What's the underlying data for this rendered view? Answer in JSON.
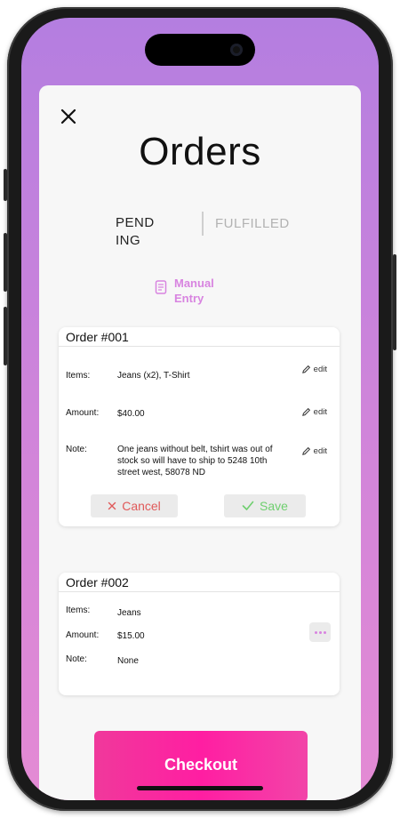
{
  "screen": {
    "title": "Orders"
  },
  "tabs": [
    {
      "label": "PEND ING",
      "active": true
    },
    {
      "label": "FULFILLED",
      "active": false
    }
  ],
  "manual_entry": {
    "label": "Manual Entry",
    "icon": "document-icon"
  },
  "orders": [
    {
      "title": "Order #001",
      "items_label": "Items:",
      "items": "Jeans (x2), T-Shirt",
      "amount_label": "Amount:",
      "amount": "$40.00",
      "note_label": "Note:",
      "note": "One jeans without belt, tshirt was out of stock so will have to ship to 5248 10th street west, 58078 ND",
      "edit_label": "edit",
      "cancel_label": "Cancel",
      "save_label": "Save"
    },
    {
      "title": "Order #002",
      "items_label": "Items:",
      "items": "Jeans",
      "amount_label": "Amount:",
      "amount": "$15.00",
      "note_label": "Note:",
      "note": "None"
    }
  ],
  "checkout": {
    "label": "Checkout"
  },
  "colors": {
    "accent_pink": "#ff1ea2",
    "manual_entry": "#d884e0",
    "cancel": "#e05a5a",
    "save": "#6fcf6f",
    "background_gradient_top": "#b47ee0",
    "background_gradient_bottom": "#e48ad4"
  }
}
